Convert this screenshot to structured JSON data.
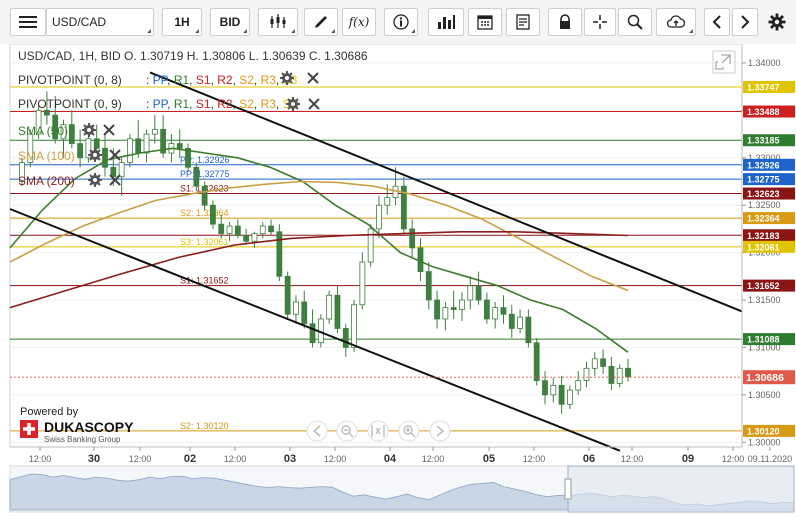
{
  "toolbar": {
    "symbol": "USD/CAD",
    "period": "1H",
    "side": "BID",
    "fx_label": "f(x)"
  },
  "header": {
    "title_line": "USD/CAD, 1H, BID   O. 1.30719 H. 1.30806 L. 1.30639 C. 1.30686"
  },
  "indicators": {
    "pivot1": {
      "name": "PIVOTPOINT (0, 8)",
      "pp": "PP",
      "r1": "R1",
      "s1": "S1",
      "r2": "R2",
      "s2": "S2",
      "r3": "R3",
      "s3": "S3"
    },
    "pivot2": {
      "name": "PIVOTPOINT (0, 9)",
      "pp": "PP",
      "r1": "R1",
      "s1": "S1",
      "r2": "R2",
      "s2": "S2",
      "r3": "R3",
      "s3": "S3"
    },
    "sma50": "SMA (50)",
    "sma100": "SMA (100)",
    "sma200": "SMA (200)"
  },
  "branding": {
    "powered_by": "Powered by",
    "name": "DUKASCOPY",
    "tagline": "Swiss Banking Group"
  },
  "colors": {
    "sma50": "#3b7d2b",
    "sma100": "#c8a043",
    "sma200": "#8b1c1c",
    "candle": "#3f7f3f",
    "level_red": "#cc1f1f",
    "level_yellow": "#e0c400",
    "level_orange": "#d79a12",
    "level_green": "#2f7d2f",
    "level_blue": "#1e63c9",
    "level_darkred": "#8b1515",
    "last_price": "#e05a4a"
  },
  "chart_data": {
    "type": "candlestick",
    "ylim": [
      1.2995,
      1.342
    ],
    "y_ticks": [
      "1.34000",
      "1.33500",
      "1.33000",
      "1.32500",
      "1.32000",
      "1.31500",
      "1.31000",
      "1.30500",
      "1.30000"
    ],
    "x_ticks": [
      "12:00",
      "30",
      "12:00",
      "02",
      "12:00",
      "03",
      "12:00",
      "04",
      "12:00",
      "05",
      "12:00",
      "06",
      "12:00",
      "09",
      "12:00",
      "09.11.2020"
    ],
    "last_price": "1.30686",
    "levels": [
      {
        "value": 1.33747,
        "label": "",
        "axis": "1.33747",
        "color": "level_yellow"
      },
      {
        "value": 1.33488,
        "label": "",
        "axis": "1.33488",
        "color": "level_red"
      },
      {
        "value": 1.33185,
        "label": "",
        "axis": "1.33185",
        "color": "level_green"
      },
      {
        "value": 1.32926,
        "label": "PP: 1.32926",
        "axis": "1.32926",
        "color": "level_blue"
      },
      {
        "value": 1.32775,
        "label": "PP: 1.32775",
        "axis": "1.32775",
        "color": "level_blue"
      },
      {
        "value": 1.32623,
        "label": "S1: 1.32623",
        "axis": "1.32623",
        "color": "level_darkred"
      },
      {
        "value": 1.32364,
        "label": "S2: 1.32364",
        "axis": "1.32364",
        "color": "level_orange"
      },
      {
        "value": 1.32183,
        "label": "",
        "axis": "1.32183",
        "color": "level_darkred"
      },
      {
        "value": 1.32061,
        "label": "S3: 1.32061",
        "axis": "1.32061",
        "color": "level_yellow"
      },
      {
        "value": 1.31652,
        "label": "S1: 1.31652",
        "axis": "1.31652",
        "color": "level_darkred"
      },
      {
        "value": 1.31088,
        "label": "",
        "axis": "1.31088",
        "color": "level_green"
      },
      {
        "value": 1.3012,
        "label": "S2: 1.30120",
        "axis": "1.30120",
        "color": "level_orange"
      }
    ],
    "sma50": [
      1.3205,
      1.3245,
      1.3278,
      1.3298,
      1.3305,
      1.331,
      1.3305,
      1.33,
      1.329,
      1.3275,
      1.325,
      1.323,
      1.32,
      1.3185,
      1.3175,
      1.3165,
      1.315,
      1.314,
      1.312,
      1.3095
    ],
    "sma100": [
      1.319,
      1.321,
      1.3228,
      1.3242,
      1.3255,
      1.3262,
      1.3268,
      1.3272,
      1.3275,
      1.3274,
      1.327,
      1.3262,
      1.325,
      1.3235,
      1.3215,
      1.3195,
      1.3175,
      1.316
    ],
    "sma200": [
      1.3142,
      1.316,
      1.3178,
      1.3195,
      1.3208,
      1.3215,
      1.3218,
      1.322,
      1.3222,
      1.3222,
      1.322,
      1.3218
    ],
    "trend_upper": [
      1.339,
      1.3138
    ],
    "trend_lower": [
      1.3246,
      1.2991
    ],
    "candles": [
      [
        1.3275,
        1.33,
        1.327,
        1.3295
      ],
      [
        1.3295,
        1.333,
        1.329,
        1.3325
      ],
      [
        1.3325,
        1.3355,
        1.332,
        1.335
      ],
      [
        1.335,
        1.337,
        1.3335,
        1.3345
      ],
      [
        1.3345,
        1.3365,
        1.3315,
        1.332
      ],
      [
        1.332,
        1.334,
        1.33,
        1.3335
      ],
      [
        1.3335,
        1.335,
        1.331,
        1.3315
      ],
      [
        1.3315,
        1.333,
        1.329,
        1.33
      ],
      [
        1.33,
        1.3325,
        1.3295,
        1.332
      ],
      [
        1.332,
        1.3335,
        1.3305,
        1.331
      ],
      [
        1.331,
        1.3325,
        1.328,
        1.329
      ],
      [
        1.329,
        1.331,
        1.327,
        1.328
      ],
      [
        1.328,
        1.33,
        1.326,
        1.3295
      ],
      [
        1.3295,
        1.3325,
        1.329,
        1.332
      ],
      [
        1.332,
        1.334,
        1.33,
        1.3305
      ],
      [
        1.3305,
        1.333,
        1.3295,
        1.3325
      ],
      [
        1.3325,
        1.3345,
        1.3315,
        1.333
      ],
      [
        1.333,
        1.3345,
        1.33,
        1.3305
      ],
      [
        1.3305,
        1.3325,
        1.3295,
        1.3315
      ],
      [
        1.3315,
        1.333,
        1.33,
        1.331
      ],
      [
        1.331,
        1.3315,
        1.3285,
        1.329
      ],
      [
        1.329,
        1.3295,
        1.3265,
        1.327
      ],
      [
        1.327,
        1.3275,
        1.3245,
        1.325
      ],
      [
        1.325,
        1.3255,
        1.3225,
        1.323
      ],
      [
        1.323,
        1.324,
        1.3215,
        1.322
      ],
      [
        1.322,
        1.3232,
        1.3212,
        1.3228
      ],
      [
        1.3228,
        1.3235,
        1.3215,
        1.3218
      ],
      [
        1.3218,
        1.3225,
        1.3208,
        1.3212
      ],
      [
        1.3212,
        1.3222,
        1.3205,
        1.322
      ],
      [
        1.322,
        1.3232,
        1.3215,
        1.3228
      ],
      [
        1.3228,
        1.3235,
        1.3218,
        1.3222
      ],
      [
        1.3222,
        1.323,
        1.317,
        1.3175
      ],
      [
        1.3175,
        1.318,
        1.313,
        1.3135
      ],
      [
        1.3135,
        1.3155,
        1.3125,
        1.3148
      ],
      [
        1.3148,
        1.316,
        1.312,
        1.3125
      ],
      [
        1.3125,
        1.314,
        1.31,
        1.3105
      ],
      [
        1.3105,
        1.3135,
        1.31,
        1.313
      ],
      [
        1.313,
        1.316,
        1.3125,
        1.3155
      ],
      [
        1.3155,
        1.3165,
        1.3115,
        1.312
      ],
      [
        1.312,
        1.3125,
        1.309,
        1.31
      ],
      [
        1.31,
        1.315,
        1.3095,
        1.3145
      ],
      [
        1.3145,
        1.32,
        1.314,
        1.319
      ],
      [
        1.319,
        1.323,
        1.3185,
        1.3225
      ],
      [
        1.3225,
        1.326,
        1.3215,
        1.325
      ],
      [
        1.325,
        1.3272,
        1.324,
        1.3258
      ],
      [
        1.3258,
        1.329,
        1.325,
        1.327
      ],
      [
        1.327,
        1.328,
        1.322,
        1.3225
      ],
      [
        1.3225,
        1.3235,
        1.3195,
        1.3205
      ],
      [
        1.3205,
        1.3215,
        1.317,
        1.318
      ],
      [
        1.318,
        1.319,
        1.314,
        1.315
      ],
      [
        1.315,
        1.316,
        1.312,
        1.313
      ],
      [
        1.313,
        1.3148,
        1.3118,
        1.3142
      ],
      [
        1.3142,
        1.316,
        1.313,
        1.314
      ],
      [
        1.314,
        1.3158,
        1.3128,
        1.315
      ],
      [
        1.315,
        1.3175,
        1.314,
        1.3165
      ],
      [
        1.3165,
        1.318,
        1.3145,
        1.315
      ],
      [
        1.315,
        1.3158,
        1.3125,
        1.313
      ],
      [
        1.313,
        1.3148,
        1.312,
        1.3142
      ],
      [
        1.3142,
        1.3155,
        1.3125,
        1.3135
      ],
      [
        1.3135,
        1.3145,
        1.311,
        1.312
      ],
      [
        1.312,
        1.314,
        1.3115,
        1.3132
      ],
      [
        1.3132,
        1.314,
        1.31,
        1.3105
      ],
      [
        1.3105,
        1.311,
        1.306,
        1.3065
      ],
      [
        1.3065,
        1.3075,
        1.304,
        1.305
      ],
      [
        1.305,
        1.3068,
        1.3042,
        1.306
      ],
      [
        1.306,
        1.307,
        1.303,
        1.304
      ],
      [
        1.304,
        1.306,
        1.3035,
        1.3055
      ],
      [
        1.3055,
        1.3075,
        1.305,
        1.3065
      ],
      [
        1.3065,
        1.3085,
        1.3058,
        1.3078
      ],
      [
        1.3078,
        1.3095,
        1.307,
        1.3088
      ],
      [
        1.3088,
        1.3098,
        1.3072,
        1.308
      ],
      [
        1.308,
        1.309,
        1.3055,
        1.3062
      ],
      [
        1.3062,
        1.3082,
        1.3058,
        1.3078
      ],
      [
        1.3078,
        1.3088,
        1.3064,
        1.3069
      ]
    ]
  }
}
